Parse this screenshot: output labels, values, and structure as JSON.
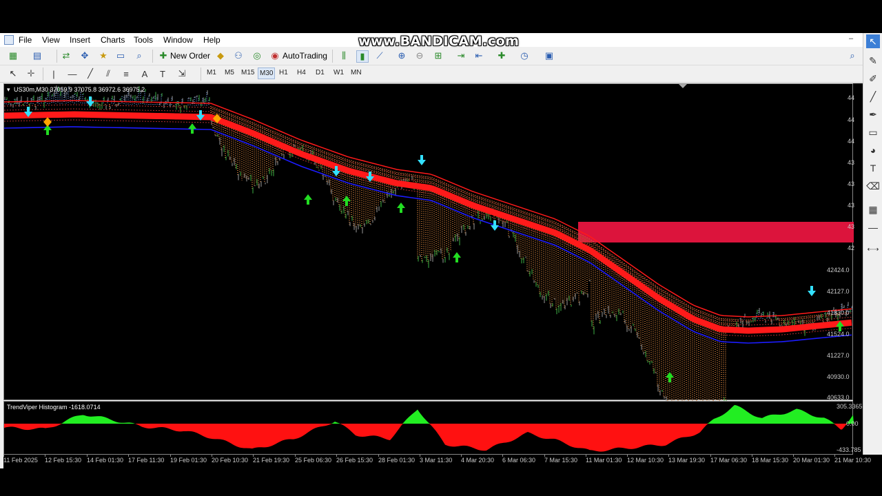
{
  "watermark": "www.BANDICAM.com",
  "menu": [
    "File",
    "View",
    "Insert",
    "Charts",
    "Tools",
    "Window",
    "Help"
  ],
  "toolbar": {
    "new_order": "New Order",
    "auto_trading": "AutoTrading"
  },
  "timeframes": [
    "M1",
    "M5",
    "M15",
    "M30",
    "H1",
    "H4",
    "D1",
    "W1",
    "MN"
  ],
  "active_timeframe": "M30",
  "chart": {
    "symbol_info": "US30m,M30  37059.9 37075.8 36972.6 36975.2",
    "price_labels_visible": [
      "42424.0",
      "42127.0",
      "41830.0",
      "41524.0",
      "41227.0",
      "40930.0",
      "40633.0"
    ],
    "price_labels_clipped": [
      "44",
      "44",
      "44",
      "43",
      "43",
      "43",
      "43",
      "42"
    ]
  },
  "indicator": {
    "title": "TrendViper Histogram -1618.0714",
    "ticks": [
      "305.3365",
      "0.00",
      "-433.785"
    ]
  },
  "x_axis": [
    "11 Feb 2025",
    "12 Feb 15:30",
    "14 Feb 01:30",
    "17 Feb 11:30",
    "19 Feb 01:30",
    "20 Feb 10:30",
    "21 Feb 19:30",
    "25 Feb 06:30",
    "26 Feb 15:30",
    "28 Feb 01:30",
    "3 Mar 11:30",
    "4 Mar 20:30",
    "6 Mar 06:30",
    "7 Mar 15:30",
    "11 Mar 01:30",
    "12 Mar 10:30",
    "13 Mar 19:30",
    "17 Mar 06:30",
    "18 Mar 15:30",
    "20 Mar 01:30",
    "21 Mar 10:30"
  ],
  "colors": {
    "band": "#ff1a1a",
    "zone": "#dc143c",
    "ma": "#1c1cff",
    "hist_up": "#22ee22",
    "hist_down": "#ff1111",
    "arrow_down": "#33e0ff",
    "arrow_up": "#22dd22",
    "diamond": "#ffa500"
  }
}
